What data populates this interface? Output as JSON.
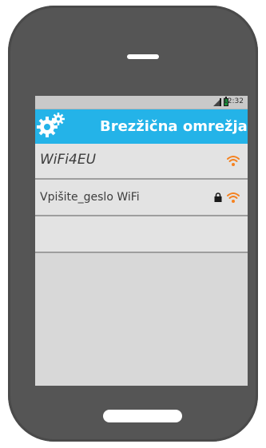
{
  "status_bar": {
    "time": "12:32"
  },
  "title_bar": {
    "title": "Brezžična omrežja",
    "icon": "gears-icon"
  },
  "networks": [
    {
      "ssid": "WiFi4EU",
      "secured": false,
      "icon": "wifi-icon"
    },
    {
      "ssid": "Vpišite_geslo WiFi",
      "secured": true,
      "icon": "wifi-icon"
    }
  ],
  "colors": {
    "accent": "#24b3e8",
    "wifi": "#f58220",
    "phone_body": "#555555",
    "screen": "#d8d8d8"
  }
}
